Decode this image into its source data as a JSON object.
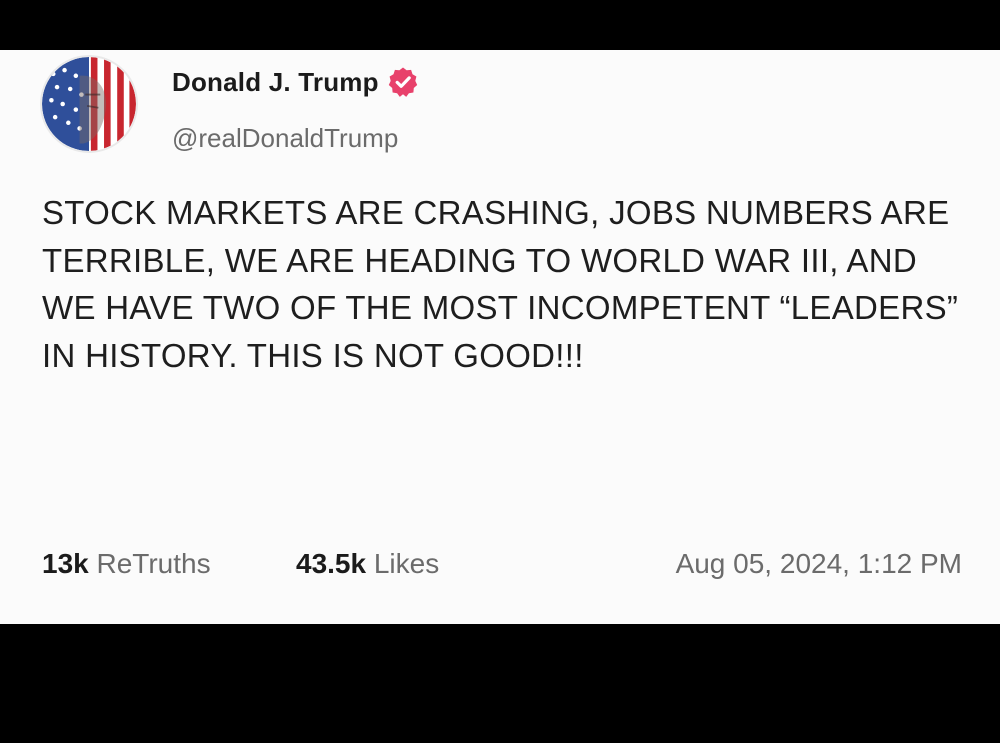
{
  "post": {
    "author": {
      "display_name": "Donald J. Trump",
      "handle": "@realDonaldTrump",
      "verified": true,
      "avatar_icon": "flag-portrait-avatar",
      "badge_icon": "verified-badge-icon"
    },
    "body": "STOCK MARKETS ARE CRASHING, JOBS NUMBERS ARE TERRIBLE, WE ARE HEADING TO WORLD WAR III, AND WE HAVE TWO OF THE MOST INCOMPETENT “LEADERS” IN HISTORY. THIS IS NOT GOOD!!!",
    "stats": {
      "retruths_count": "13k",
      "retruths_label": "ReTruths",
      "likes_count": "43.5k",
      "likes_label": "Likes"
    },
    "timestamp": "Aug 05, 2024, 1:12 PM"
  },
  "colors": {
    "page_background": "#000000",
    "card_background": "#fbfbfb",
    "badge": "#e8416b",
    "muted_text": "#6b6b6b",
    "primary_text": "#1b1b1b"
  }
}
